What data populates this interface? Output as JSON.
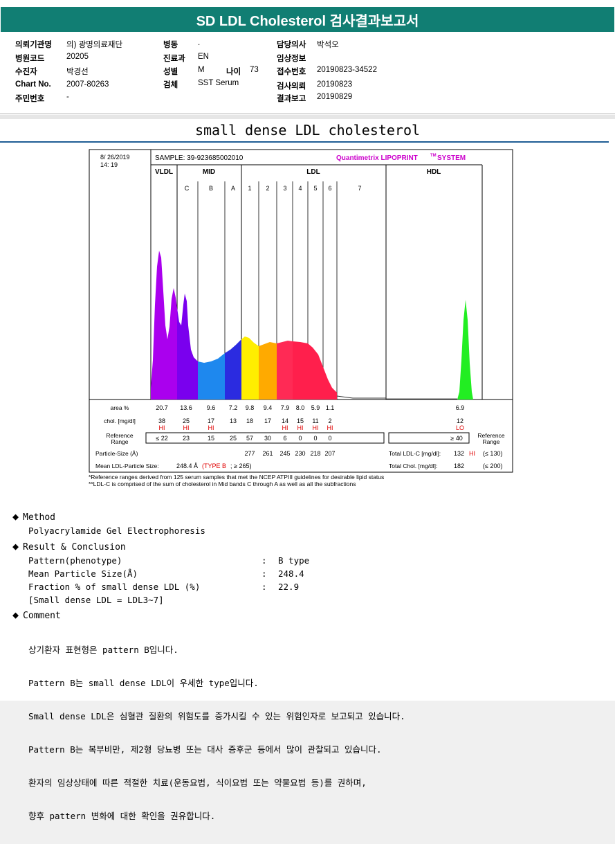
{
  "header": {
    "title": "SD LDL Cholesterol 검사결과보고서"
  },
  "info": {
    "col1": [
      {
        "label": "의뢰기관명",
        "value": "의) 광명의료재단"
      },
      {
        "label": "병원코드",
        "value": "20205"
      },
      {
        "label": "수진자",
        "value": "박경선"
      },
      {
        "label": "Chart No.",
        "value": "2007-80263"
      },
      {
        "label": "주민번호",
        "value": "-"
      }
    ],
    "col2": [
      {
        "label": "병동",
        "value": "."
      },
      {
        "label": "진료과",
        "value": "EN"
      },
      {
        "label": "성별",
        "value": "M"
      },
      {
        "label": "검체",
        "value": "SST Serum"
      }
    ],
    "age": {
      "label": "나이",
      "value": "73"
    },
    "col3": [
      {
        "label": "담당의사",
        "value": "박석오"
      },
      {
        "label": "임상정보",
        "value": ""
      },
      {
        "label": "접수번호",
        "value": "20190823-34522"
      },
      {
        "label": "검사의뢰",
        "value": "20190823"
      },
      {
        "label": "결과보고",
        "value": "20190829"
      }
    ]
  },
  "subtitle": "small dense LDL cholesterol",
  "chart_data": {
    "type": "area",
    "date": "8/ 26/2019",
    "time": "14: 19",
    "sample": "SAMPLE:  39-923685002010",
    "brand": "Quantimetrix LIPOPRINT",
    "brand_sup": "TM",
    "brand_tail": "SYSTEM",
    "groups": [
      "VLDL",
      "MID",
      "LDL",
      "HDL"
    ],
    "bands": [
      "C",
      "B",
      "A",
      "1",
      "2",
      "3",
      "4",
      "5",
      "6",
      "7"
    ],
    "band_colors": {
      "VLDL": "#aa00ee",
      "C": "#7a00ee",
      "B": "#1e88ee",
      "A": "#2b2be0",
      "1": "#ffee00",
      "2": "#ffaa00",
      "3": "#ff2a55",
      "4": "#ff1f4c",
      "5": "#ff1f4c",
      "6": "#ff1f4c",
      "HDL": "#22ee22"
    },
    "row_labels": {
      "area": "area %",
      "chol": "chol. [mg/dl]",
      "ref": "Reference Range",
      "ref_right": "Reference Range",
      "psize": "Particle-Size (Å)",
      "mean": "Mean LDL-Particle Size:"
    },
    "area": [
      "20.7",
      "13.6",
      "9.6",
      "7.2",
      "9.8",
      "9.4",
      "7.9",
      "8.0",
      "5.9",
      "1.1"
    ],
    "chol": [
      "38",
      "25",
      "17",
      "13",
      "18",
      "17",
      "14",
      "15",
      "11",
      "2"
    ],
    "flags": [
      "HI",
      "HI",
      "HI",
      "",
      "",
      "",
      "HI",
      "HI",
      "HI",
      "HI"
    ],
    "ref": [
      "≤ 22",
      "23",
      "15",
      "25",
      "57",
      "30",
      "6",
      "0",
      "0",
      "0"
    ],
    "particle_size": [
      "277",
      "261",
      "245",
      "230",
      "218",
      "207"
    ],
    "hdl": {
      "area": "6.9",
      "chol": "12",
      "flag": "LO",
      "ref": "≥ 40"
    },
    "mean_value": "248.4 Å",
    "mean_type": "(TYPE B",
    "mean_ref": "; ≥ 265)",
    "total_ldl": {
      "label": "Total LDL-C [mg/dl]:",
      "value": "132",
      "flag": "HI",
      "ref": "(≤ 130)"
    },
    "total_chol": {
      "label": "Total Chol. [mg/dl]:",
      "value": "182",
      "ref": "(≤ 200)"
    }
  },
  "notes": [
    "*Reference ranges derived from 125 serum samples that met the NCEP ATPIII guidelines for desirable lipid status",
    "**LDL-C is comprised of the sum of cholesterol in Mid bands C through A as well as all the subfractions"
  ],
  "method": {
    "title": "Method",
    "text": "Polyacrylamide Gel Electrophoresis"
  },
  "result": {
    "title": "Result & Conclusion",
    "rows": [
      {
        "label": "Pattern(phenotype)",
        "value": "B type"
      },
      {
        "label": "Mean Particle Size(Å)",
        "value": "248.4"
      },
      {
        "label": "Fraction % of small dense LDL (%)",
        "value": "22.9"
      }
    ],
    "note": "[Small dense LDL = LDL3~7]"
  },
  "comment": {
    "title": "Comment",
    "lines": [
      "상기환자 표현형은 pattern B입니다.",
      "Pattern B는 small dense LDL이 우세한 type입니다.",
      "Small dense LDL은 심혈관 질환의 위험도를 증가시킬 수 있는 위험인자로 보고되고 있습니다.",
      "Pattern B는 복부비만, 제2형 당뇨병 또는 대사 증후군 등에서 많이 관찰되고 있습니다.",
      "환자의 임상상태에 따른 적절한 치료(운동요법, 식이요법 또는 약물요법 등)를 권하며,",
      "향후 pattern 변화에 대한 확인을 권유합니다."
    ]
  },
  "colon": ":"
}
